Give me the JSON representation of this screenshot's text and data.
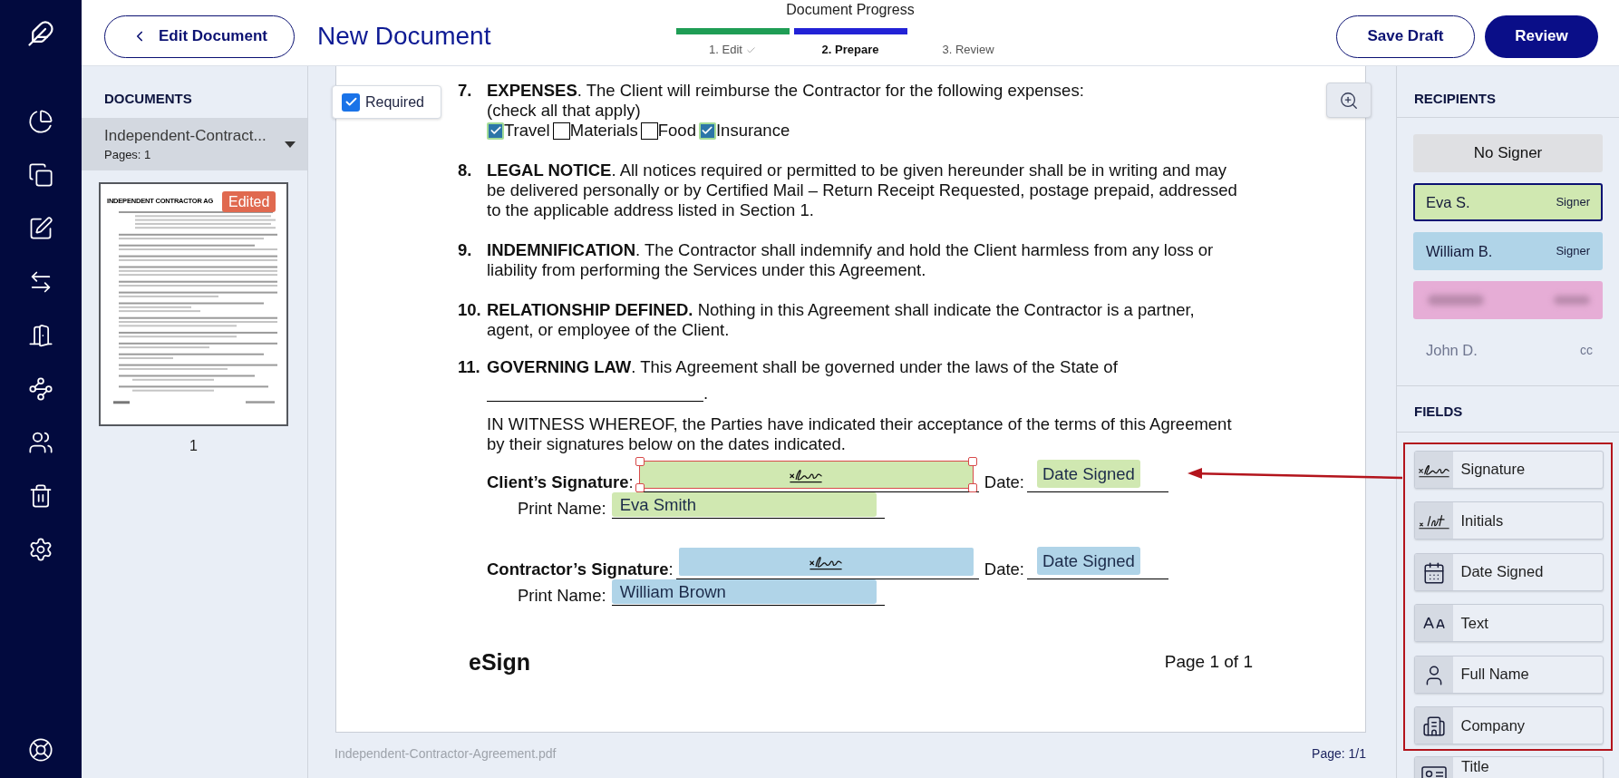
{
  "header": {
    "back_button": "Edit Document",
    "title": "New Document",
    "progress": {
      "title": "Document Progress",
      "steps": [
        {
          "label": "1. Edit",
          "done": true,
          "selected": false
        },
        {
          "label": "2. Prepare",
          "done": false,
          "selected": true
        },
        {
          "label": "3. Review",
          "done": false,
          "selected": false
        }
      ]
    },
    "buttons": [
      {
        "label": "Save Draft",
        "kind": "secondary"
      },
      {
        "label": "Review",
        "kind": "primary"
      }
    ]
  },
  "documents_panel": {
    "title": "DOCUMENTS",
    "documents": [
      {
        "name": "Independent-Contract...",
        "pages": "Pages: 1",
        "selected": true
      }
    ],
    "thumbnail": {
      "title": "INDEPENDENT CONTRACTOR AG",
      "badge": "Edited",
      "page_number": "1"
    }
  },
  "editor": {
    "required_toggle": {
      "label": "Required",
      "checked": true
    },
    "sections": [
      {
        "number": "7.",
        "text": "**EXPENSES**. The Client will reimburse the Contractor for the following expenses:\n(check all that apply)",
        "options": [
          {
            "label": "Travel",
            "checked": true
          },
          {
            "label": "Materials",
            "checked": false
          },
          {
            "label": "Food",
            "checked": false
          },
          {
            "label": "Insurance",
            "checked": true
          }
        ]
      },
      {
        "number": "8.",
        "text": "**LEGAL NOTICE**. All notices required or permitted to be given hereunder shall be in writing and may\nbe delivered personally or by Certified Mail – Return Receipt Requested, postage prepaid, addressed\nto the applicable address listed in Section 1."
      },
      {
        "number": "9.",
        "text": "**INDEMNIFICATION**. The Contractor shall indemnify and hold the Client harmless from any loss or\nliability from performing the Services under this Agreement."
      },
      {
        "number": "10.",
        "text": "**RELATIONSHIP DEFINED.** Nothing in this Agreement shall indicate the Contractor is a partner,\nagent, or employee of the Client."
      },
      {
        "number": "11.",
        "text": "**GOVERNING LAW**. This Agreement shall be governed under the laws of the State of",
        "blank_suffix": "."
      }
    ],
    "witness": "IN WITNESS WHEREOF, the Parties have indicated their acceptance of the terms of this Agreement\nby their signatures below on the dates indicated.",
    "signature_rows": [
      {
        "label": "**Client’s Signature**:",
        "signature_field": {
          "color": "#d0e8b1",
          "selected": true
        },
        "date_label": "Date:",
        "date_field": {
          "text": "Date Signed",
          "color": "#d0e8b1"
        },
        "print_label": "Print Name:",
        "name_field": {
          "text": "Eva Smith",
          "color": "#d0e8b1"
        }
      },
      {
        "label": "**Contractor’s Signature**:",
        "signature_field": {
          "color": "#b0d4e8",
          "selected": false
        },
        "date_label": "Date:",
        "date_field": {
          "text": "Date Signed",
          "color": "#b0d4e8"
        },
        "print_label": "Print Name:",
        "name_field": {
          "text": "William Brown",
          "color": "#b0d4e8"
        }
      }
    ],
    "page_footer": {
      "logo": "eSign",
      "page": "Page 1 of 1"
    },
    "status": {
      "file_name": "Independent-Contractor-Agreement.pdf",
      "page": "Page: 1/1"
    }
  },
  "right_panel": {
    "recipients_title": "RECIPIENTS",
    "recipients": [
      {
        "kind": "none",
        "name": "No Signer",
        "color": "#dfe0e3",
        "selected": false
      },
      {
        "kind": "signer",
        "name": "Eva S.",
        "role": "Signer",
        "color": "#d0e8b1",
        "selected": true
      },
      {
        "kind": "signer",
        "name": "William B.",
        "role": "Signer",
        "color": "#b0d4e8",
        "selected": false
      },
      {
        "kind": "redacted",
        "color": "#e6add6",
        "selected": false
      },
      {
        "kind": "cc",
        "name": "John D.",
        "role": "cc",
        "selected": false
      }
    ],
    "fields_title": "FIELDS",
    "fields": [
      {
        "kind": "signature",
        "label": "Signature",
        "highlighted": true
      },
      {
        "kind": "initials",
        "label": "Initials",
        "highlighted": true
      },
      {
        "kind": "date",
        "label": "Date Signed",
        "highlighted": true
      },
      {
        "kind": "text",
        "label": "Text",
        "highlighted": true
      },
      {
        "kind": "name",
        "label": "Full Name",
        "highlighted": true
      },
      {
        "kind": "company",
        "label": "Company",
        "highlighted": true
      },
      {
        "kind": "title",
        "label": "Title",
        "highlighted": false
      }
    ]
  }
}
